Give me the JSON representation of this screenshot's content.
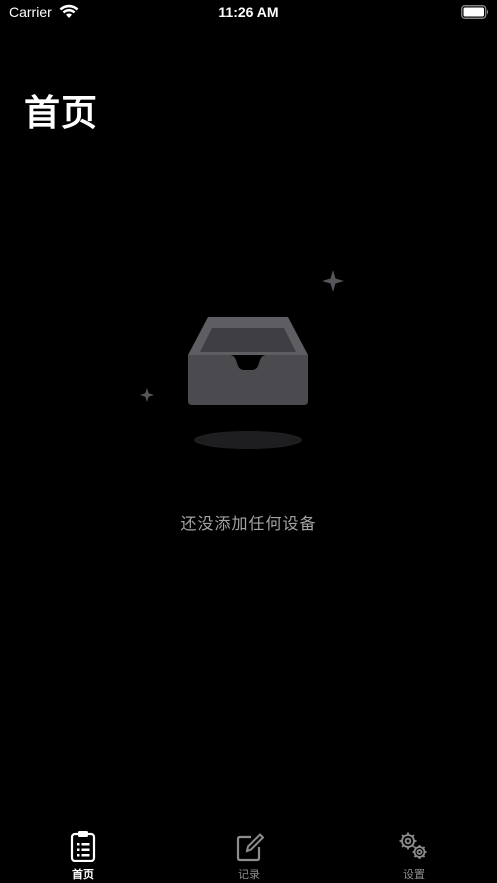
{
  "status_bar": {
    "carrier": "Carrier",
    "time": "11:26 AM",
    "icons": [
      "wifi-icon",
      "battery-icon"
    ]
  },
  "page": {
    "title": "首页"
  },
  "empty_state": {
    "message": "还没添加任何设备",
    "icon": "empty-inbox-icon"
  },
  "tab_bar": {
    "tabs": [
      {
        "label": "首页",
        "icon": "clipboard-list-icon",
        "active": true
      },
      {
        "label": "记录",
        "icon": "edit-icon",
        "active": false
      },
      {
        "label": "设置",
        "icon": "gears-icon",
        "active": false
      }
    ]
  },
  "colors": {
    "background": "#000000",
    "text_primary": "#ffffff",
    "text_secondary": "#a3a3a6",
    "tab_inactive": "#8d8d90",
    "illustration_gray": "#5a5a5e"
  }
}
